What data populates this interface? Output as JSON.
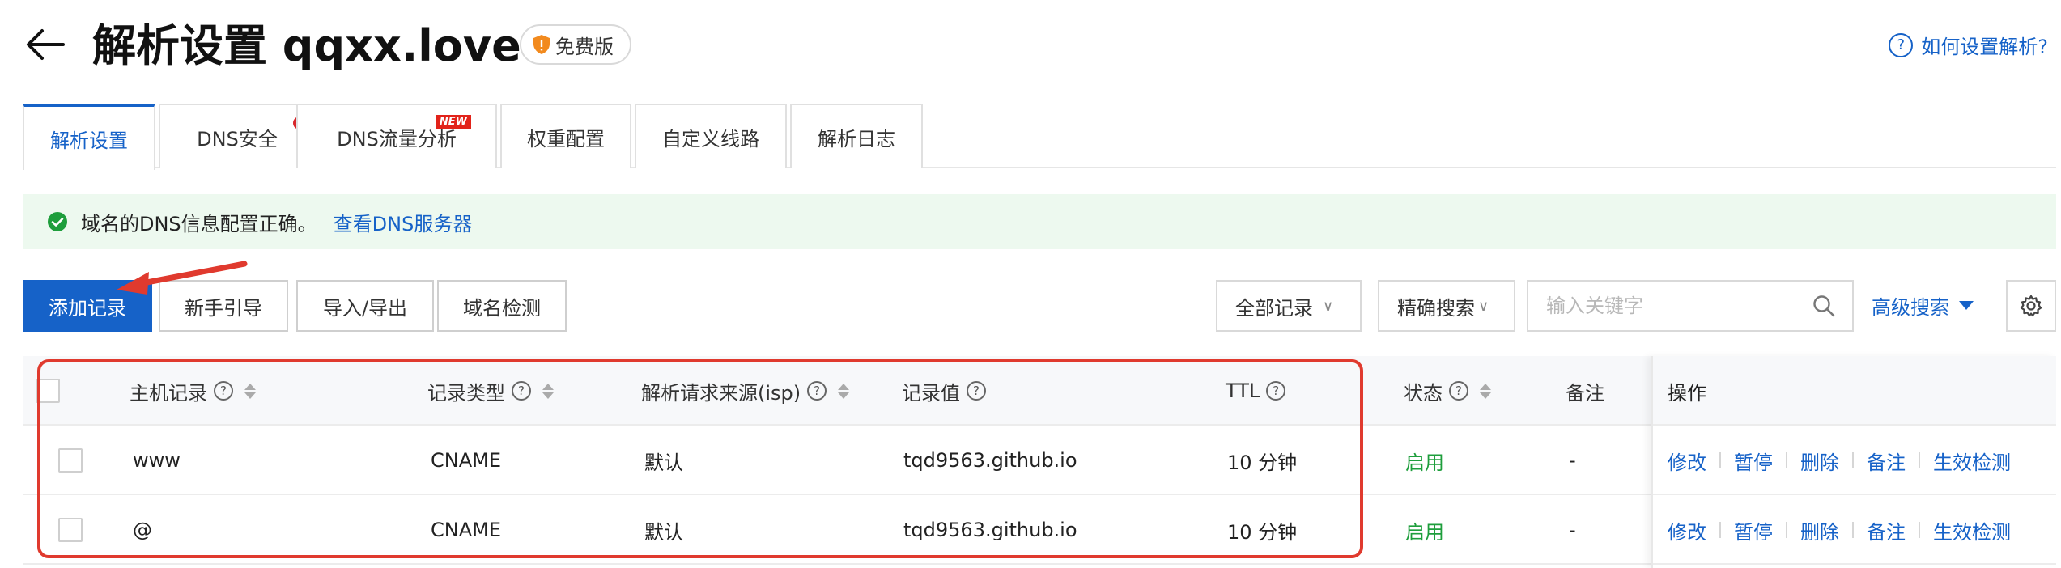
{
  "header": {
    "title": "解析设置 qqxx.love",
    "badge": "免费版",
    "help_link": "如何设置解析?"
  },
  "tabs": [
    {
      "label": "解析设置",
      "active": true
    },
    {
      "label": "DNS安全",
      "dot": true
    },
    {
      "label": "DNS流量分析",
      "new_badge": "NEW"
    },
    {
      "label": "权重配置"
    },
    {
      "label": "自定义线路"
    },
    {
      "label": "解析日志"
    }
  ],
  "info": {
    "message": "域名的DNS信息配置正确。",
    "link": "查看DNS服务器"
  },
  "toolbar": {
    "add_record": "添加记录",
    "guide": "新手引导",
    "import_export": "导入/导出",
    "domain_check": "域名检测",
    "filter_select": "全部记录",
    "search_mode": "精确搜索",
    "search_placeholder": "输入关键字",
    "advanced_search": "高级搜索"
  },
  "table": {
    "columns": {
      "host": "主机记录",
      "type": "记录类型",
      "isp": "解析请求来源(isp)",
      "value": "记录值",
      "ttl": "TTL",
      "status": "状态",
      "remark": "备注",
      "ops": "操作"
    },
    "rows": [
      {
        "host": "www",
        "type": "CNAME",
        "isp": "默认",
        "value": "tqd9563.github.io",
        "ttl": "10 分钟",
        "status": "启用",
        "remark": "-"
      },
      {
        "host": "@",
        "type": "CNAME",
        "isp": "默认",
        "value": "tqd9563.github.io",
        "ttl": "10 分钟",
        "status": "启用",
        "remark": "-"
      }
    ],
    "actions": {
      "edit": "修改",
      "pause": "暂停",
      "delete": "删除",
      "remark": "备注",
      "verify": "生效检测"
    }
  },
  "colors": {
    "accent": "#1662c8",
    "success": "#1e9e3c",
    "annotation": "#e03a2e",
    "info_bg": "#edf9ef"
  }
}
